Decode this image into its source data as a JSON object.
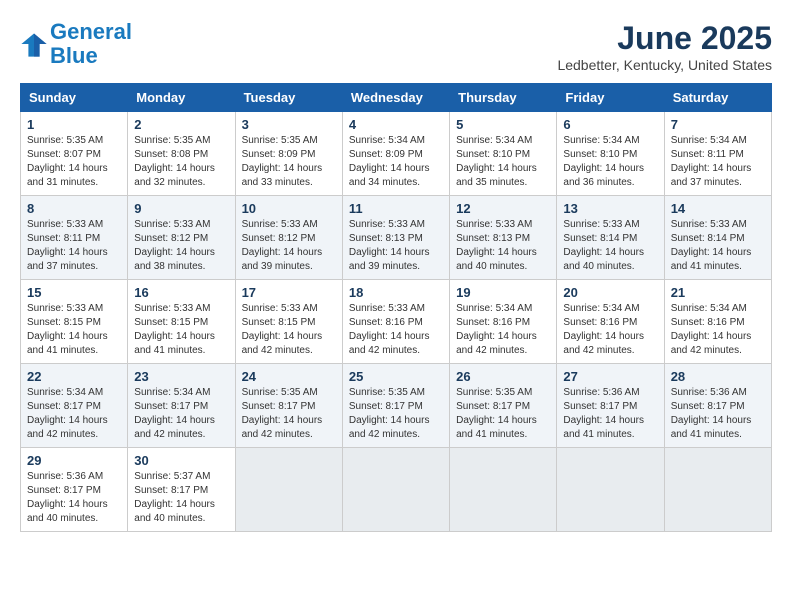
{
  "header": {
    "logo_line1": "General",
    "logo_line2": "Blue",
    "month_title": "June 2025",
    "location": "Ledbetter, Kentucky, United States"
  },
  "weekdays": [
    "Sunday",
    "Monday",
    "Tuesday",
    "Wednesday",
    "Thursday",
    "Friday",
    "Saturday"
  ],
  "weeks": [
    [
      {
        "day": "1",
        "sunrise": "Sunrise: 5:35 AM",
        "sunset": "Sunset: 8:07 PM",
        "daylight": "Daylight: 14 hours and 31 minutes."
      },
      {
        "day": "2",
        "sunrise": "Sunrise: 5:35 AM",
        "sunset": "Sunset: 8:08 PM",
        "daylight": "Daylight: 14 hours and 32 minutes."
      },
      {
        "day": "3",
        "sunrise": "Sunrise: 5:35 AM",
        "sunset": "Sunset: 8:09 PM",
        "daylight": "Daylight: 14 hours and 33 minutes."
      },
      {
        "day": "4",
        "sunrise": "Sunrise: 5:34 AM",
        "sunset": "Sunset: 8:09 PM",
        "daylight": "Daylight: 14 hours and 34 minutes."
      },
      {
        "day": "5",
        "sunrise": "Sunrise: 5:34 AM",
        "sunset": "Sunset: 8:10 PM",
        "daylight": "Daylight: 14 hours and 35 minutes."
      },
      {
        "day": "6",
        "sunrise": "Sunrise: 5:34 AM",
        "sunset": "Sunset: 8:10 PM",
        "daylight": "Daylight: 14 hours and 36 minutes."
      },
      {
        "day": "7",
        "sunrise": "Sunrise: 5:34 AM",
        "sunset": "Sunset: 8:11 PM",
        "daylight": "Daylight: 14 hours and 37 minutes."
      }
    ],
    [
      {
        "day": "8",
        "sunrise": "Sunrise: 5:33 AM",
        "sunset": "Sunset: 8:11 PM",
        "daylight": "Daylight: 14 hours and 37 minutes."
      },
      {
        "day": "9",
        "sunrise": "Sunrise: 5:33 AM",
        "sunset": "Sunset: 8:12 PM",
        "daylight": "Daylight: 14 hours and 38 minutes."
      },
      {
        "day": "10",
        "sunrise": "Sunrise: 5:33 AM",
        "sunset": "Sunset: 8:12 PM",
        "daylight": "Daylight: 14 hours and 39 minutes."
      },
      {
        "day": "11",
        "sunrise": "Sunrise: 5:33 AM",
        "sunset": "Sunset: 8:13 PM",
        "daylight": "Daylight: 14 hours and 39 minutes."
      },
      {
        "day": "12",
        "sunrise": "Sunrise: 5:33 AM",
        "sunset": "Sunset: 8:13 PM",
        "daylight": "Daylight: 14 hours and 40 minutes."
      },
      {
        "day": "13",
        "sunrise": "Sunrise: 5:33 AM",
        "sunset": "Sunset: 8:14 PM",
        "daylight": "Daylight: 14 hours and 40 minutes."
      },
      {
        "day": "14",
        "sunrise": "Sunrise: 5:33 AM",
        "sunset": "Sunset: 8:14 PM",
        "daylight": "Daylight: 14 hours and 41 minutes."
      }
    ],
    [
      {
        "day": "15",
        "sunrise": "Sunrise: 5:33 AM",
        "sunset": "Sunset: 8:15 PM",
        "daylight": "Daylight: 14 hours and 41 minutes."
      },
      {
        "day": "16",
        "sunrise": "Sunrise: 5:33 AM",
        "sunset": "Sunset: 8:15 PM",
        "daylight": "Daylight: 14 hours and 41 minutes."
      },
      {
        "day": "17",
        "sunrise": "Sunrise: 5:33 AM",
        "sunset": "Sunset: 8:15 PM",
        "daylight": "Daylight: 14 hours and 42 minutes."
      },
      {
        "day": "18",
        "sunrise": "Sunrise: 5:33 AM",
        "sunset": "Sunset: 8:16 PM",
        "daylight": "Daylight: 14 hours and 42 minutes."
      },
      {
        "day": "19",
        "sunrise": "Sunrise: 5:34 AM",
        "sunset": "Sunset: 8:16 PM",
        "daylight": "Daylight: 14 hours and 42 minutes."
      },
      {
        "day": "20",
        "sunrise": "Sunrise: 5:34 AM",
        "sunset": "Sunset: 8:16 PM",
        "daylight": "Daylight: 14 hours and 42 minutes."
      },
      {
        "day": "21",
        "sunrise": "Sunrise: 5:34 AM",
        "sunset": "Sunset: 8:16 PM",
        "daylight": "Daylight: 14 hours and 42 minutes."
      }
    ],
    [
      {
        "day": "22",
        "sunrise": "Sunrise: 5:34 AM",
        "sunset": "Sunset: 8:17 PM",
        "daylight": "Daylight: 14 hours and 42 minutes."
      },
      {
        "day": "23",
        "sunrise": "Sunrise: 5:34 AM",
        "sunset": "Sunset: 8:17 PM",
        "daylight": "Daylight: 14 hours and 42 minutes."
      },
      {
        "day": "24",
        "sunrise": "Sunrise: 5:35 AM",
        "sunset": "Sunset: 8:17 PM",
        "daylight": "Daylight: 14 hours and 42 minutes."
      },
      {
        "day": "25",
        "sunrise": "Sunrise: 5:35 AM",
        "sunset": "Sunset: 8:17 PM",
        "daylight": "Daylight: 14 hours and 42 minutes."
      },
      {
        "day": "26",
        "sunrise": "Sunrise: 5:35 AM",
        "sunset": "Sunset: 8:17 PM",
        "daylight": "Daylight: 14 hours and 41 minutes."
      },
      {
        "day": "27",
        "sunrise": "Sunrise: 5:36 AM",
        "sunset": "Sunset: 8:17 PM",
        "daylight": "Daylight: 14 hours and 41 minutes."
      },
      {
        "day": "28",
        "sunrise": "Sunrise: 5:36 AM",
        "sunset": "Sunset: 8:17 PM",
        "daylight": "Daylight: 14 hours and 41 minutes."
      }
    ],
    [
      {
        "day": "29",
        "sunrise": "Sunrise: 5:36 AM",
        "sunset": "Sunset: 8:17 PM",
        "daylight": "Daylight: 14 hours and 40 minutes."
      },
      {
        "day": "30",
        "sunrise": "Sunrise: 5:37 AM",
        "sunset": "Sunset: 8:17 PM",
        "daylight": "Daylight: 14 hours and 40 minutes."
      },
      {
        "day": "",
        "sunrise": "",
        "sunset": "",
        "daylight": ""
      },
      {
        "day": "",
        "sunrise": "",
        "sunset": "",
        "daylight": ""
      },
      {
        "day": "",
        "sunrise": "",
        "sunset": "",
        "daylight": ""
      },
      {
        "day": "",
        "sunrise": "",
        "sunset": "",
        "daylight": ""
      },
      {
        "day": "",
        "sunrise": "",
        "sunset": "",
        "daylight": ""
      }
    ]
  ]
}
